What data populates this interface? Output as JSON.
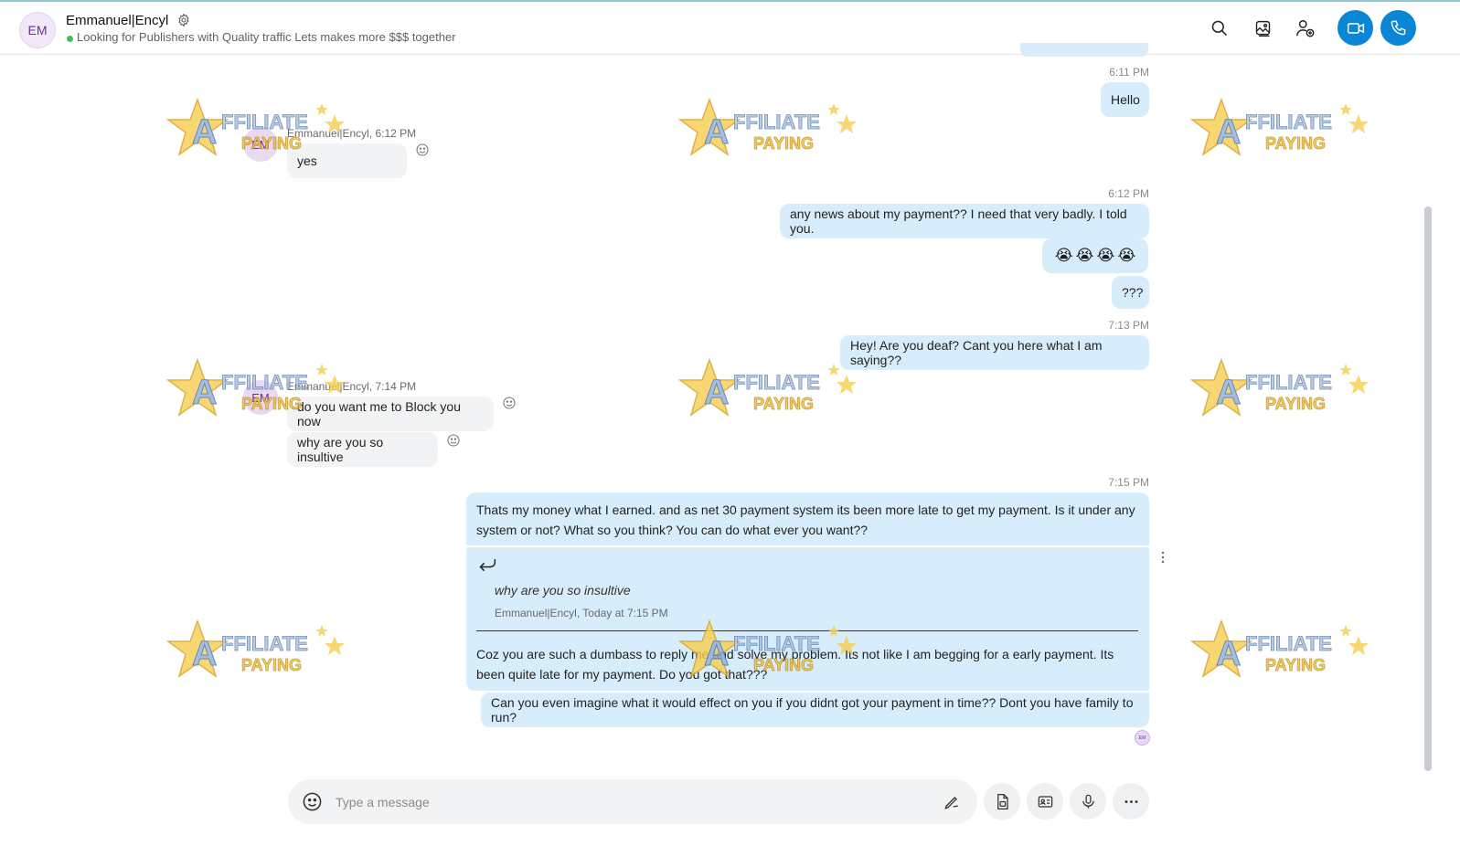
{
  "header": {
    "avatar_initials": "EM",
    "contact_name": "Emmanuel|Encyl",
    "mood_message": "Looking for Publishers with Quality traffic Lets makes more $$$ together",
    "status_color": "#3fc15b",
    "icons": [
      "search-icon",
      "gallery-icon",
      "add-person-icon",
      "video-call-icon",
      "audio-call-icon"
    ]
  },
  "conversation": {
    "avatar_initials": "EM",
    "messages": [
      {
        "time": "6:11 PM",
        "text": "Hello"
      },
      {
        "sender": "Emmanuel|Encyl, 6:12 PM",
        "text": "yes"
      },
      {
        "time": "6:12 PM",
        "text": "any news about my payment?? I need that very badly. I told you."
      },
      {
        "emojis": [
          "😭",
          "😭",
          "😭",
          "😭"
        ]
      },
      {
        "text": "???"
      },
      {
        "time": "7:13 PM",
        "text": "Hey! Are you deaf? Cant you here what I am saying??"
      },
      {
        "sender": "Emmanuel|Encyl, 7:14 PM",
        "text": "do you want me to Block you now"
      },
      {
        "text": "why are you so insultive"
      },
      {
        "time": "7:15 PM",
        "text": "Thats my money what I earned. and as net 30 payment system its been more late to get my payment. Is it under any system or not? What so you think? You can do what ever you want??"
      },
      {
        "quote_text": "why are you so insultive",
        "quote_meta": "Emmanuel|Encyl, Today at 7:15 PM",
        "text": "Coz you are such a dumbass to reply me and solve my problem. Its not like I am begging for a early payment. Its been quite late for my payment. Do you got that???"
      },
      {
        "text": "Can you even imagine what it would effect on you if you didnt got your payment in time?? Dont you have family to run?"
      }
    ],
    "read_receipt_initials": "EM"
  },
  "composer": {
    "placeholder": "Type a message",
    "value": "",
    "buttons": [
      "emoji-icon",
      "pen-icon",
      "file-icon",
      "contact-card-icon",
      "microphone-icon",
      "more-icon"
    ]
  },
  "watermark": {
    "line1": "AFFILIATE",
    "line2": "PAYING"
  },
  "colors": {
    "outgoing_bubble": "#d8edfb",
    "incoming_bubble": "#f1f3f5",
    "call_button": "#0a86d6"
  }
}
